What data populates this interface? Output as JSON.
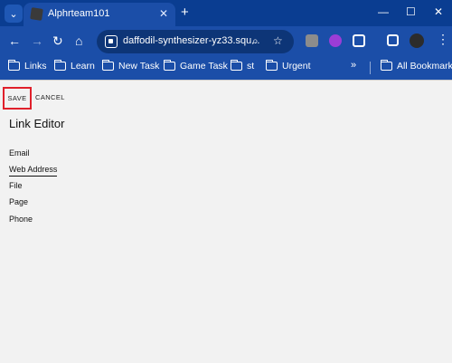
{
  "browser": {
    "tab_title": "Alphrteam101",
    "url": "daffodil-synthesizer-yz33.squ...",
    "bookmarks": [
      "Links",
      "Learn",
      "New Task",
      "Game Task",
      "st",
      "Urgent"
    ],
    "all_bookmarks_label": "All Bookmarks",
    "colors": {
      "frame": "#0a3d91",
      "toolbar": "#1b4ea8",
      "omnibox": "#0d3577"
    }
  },
  "page": {
    "save_label": "SAVE",
    "cancel_label": "CANCEL",
    "title": "Link Editor",
    "link_types": [
      "Email",
      "Web Address",
      "File",
      "Page",
      "Phone"
    ],
    "active_link_type": "Web Address",
    "highlight_color": "#e0202b"
  }
}
